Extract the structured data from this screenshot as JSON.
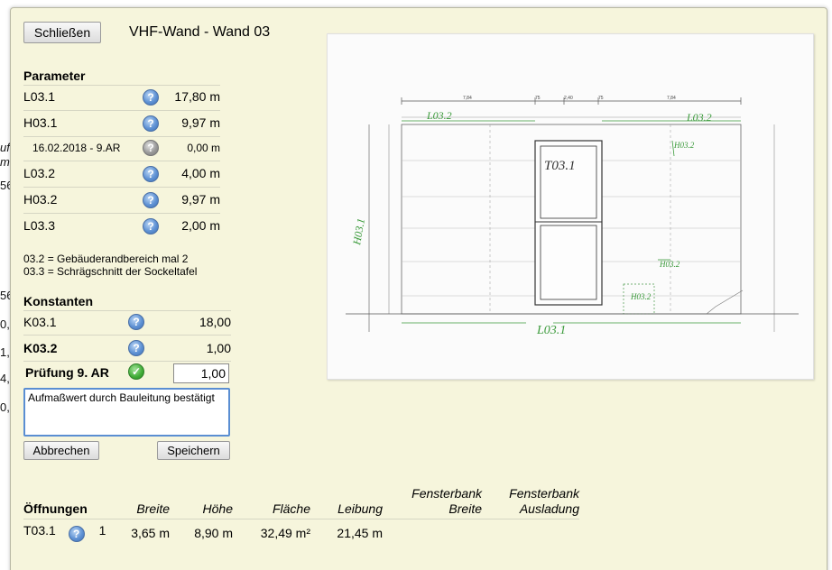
{
  "background": {
    "fragments": [
      "ufi",
      "m",
      "56",
      "56",
      "0,",
      "1,",
      "4,",
      "0,"
    ]
  },
  "dialog": {
    "close_label": "Schließen",
    "title": "VHF-Wand - Wand 03"
  },
  "parameter": {
    "heading": "Parameter",
    "rows": [
      {
        "label": "L03.1",
        "value": "17,80 m",
        "icon": "info-icon"
      },
      {
        "label": "H03.1",
        "value": "9,97 m",
        "icon": "info-icon"
      },
      {
        "label": "16.02.2018 - 9.AR",
        "value": "0,00 m",
        "icon": "info-icon-gray"
      },
      {
        "label": "L03.2",
        "value": "4,00 m",
        "icon": "info-icon"
      },
      {
        "label": "H03.2",
        "value": "9,97 m",
        "icon": "info-icon"
      },
      {
        "label": "L03.3",
        "value": "2,00 m",
        "icon": "info-icon"
      }
    ],
    "notes": [
      "03.2 = Gebäuderandbereich mal 2",
      "03.3 = Schrägschnitt der Sockeltafel"
    ]
  },
  "konstanten": {
    "heading": "Konstanten",
    "rows": [
      {
        "label": "K03.1",
        "value": "18,00",
        "icon": "info-icon"
      },
      {
        "label": "K03.2",
        "value": "1,00",
        "icon": "info-icon"
      }
    ]
  },
  "pruefung": {
    "label": "Prüfung 9. AR",
    "icon": "check-icon",
    "value": "1,00",
    "comment": "Aufmaßwert durch Bauleitung bestätigt"
  },
  "actions": {
    "cancel_label": "Abbrechen",
    "save_label": "Speichern"
  },
  "drawing": {
    "handwritten": [
      "L03.2",
      "L03.2",
      "T03.1",
      "H03.1",
      "H03.2",
      "H03.2",
      "H03.2",
      "L03.1"
    ],
    "dims": [
      "7,84",
      "75",
      "2,40",
      "75",
      "7,84"
    ]
  },
  "openings": {
    "headers": [
      "Öffnungen",
      "Breite",
      "Höhe",
      "Fläche",
      "Leibung",
      "Fensterbank Breite",
      "Fensterbank Ausladung"
    ],
    "rows": [
      {
        "name": "T03.1",
        "count": "1",
        "breite": "3,65 m",
        "hoehe": "8,90 m",
        "flaeche": "32,49 m²",
        "leibung": "21,45 m",
        "fb_breite": "",
        "fb_ausladung": ""
      }
    ]
  },
  "colors": {
    "dialog_bg": "#f6f5dc",
    "accent_blue": "#5f92d4",
    "check_green": "#3fab36",
    "handwriting_green": "#3a9a3a"
  }
}
